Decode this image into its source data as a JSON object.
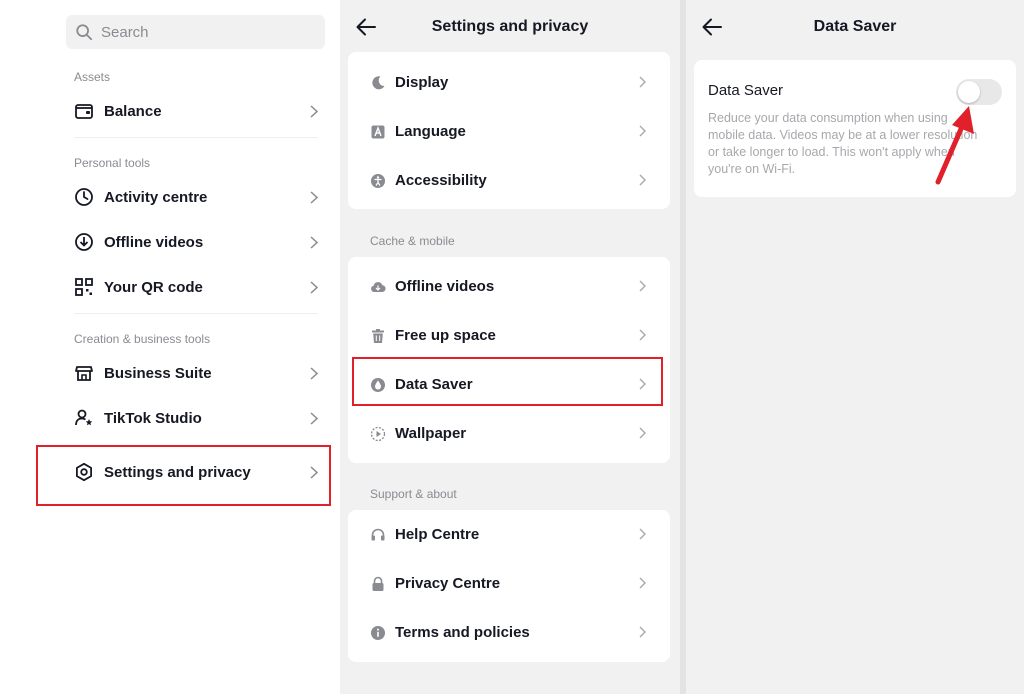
{
  "left": {
    "search_placeholder": "Search",
    "sections": {
      "assets": "Assets",
      "personal_tools": "Personal tools",
      "creation_business_tools": "Creation & business tools"
    },
    "items": {
      "balance": "Balance",
      "activity_centre": "Activity centre",
      "offline_videos": "Offline videos",
      "qr_code": "Your QR code",
      "business_suite": "Business Suite",
      "tiktok_studio": "TikTok Studio",
      "settings_privacy": "Settings and privacy"
    }
  },
  "middle": {
    "title": "Settings and privacy",
    "sections": {
      "cache_mobile": "Cache & mobile",
      "support_about": "Support & about"
    },
    "items": {
      "display": "Display",
      "language": "Language",
      "accessibility": "Accessibility",
      "offline_videos": "Offline videos",
      "free_up_space": "Free up space",
      "data_saver": "Data Saver",
      "wallpaper": "Wallpaper",
      "help_centre": "Help Centre",
      "privacy_centre": "Privacy Centre",
      "terms_policies": "Terms and policies"
    }
  },
  "right": {
    "title": "Data Saver",
    "setting_title": "Data Saver",
    "setting_description": "Reduce your data consumption when using mobile data. Videos may be at a lower resolution or take longer to load. This won't apply when you're on Wi-Fi.",
    "toggle_state": "off"
  },
  "colors": {
    "highlight_red": "#e0212b",
    "text_primary": "#161823",
    "text_secondary": "#8a8b91",
    "panel_grey": "#f1f1f2"
  },
  "icons": {
    "search": "search-icon",
    "balance": "wallet-icon",
    "activity": "clock-icon",
    "offline": "download-icon",
    "qr": "qr-code-icon",
    "business": "shop-icon",
    "studio": "person-star-icon",
    "settings": "gear-icon",
    "display": "moon-icon",
    "language": "language-icon",
    "accessibility": "accessibility-icon",
    "offline_cloud": "cloud-icon",
    "trash": "trash-icon",
    "data_saver": "droplet-icon",
    "wallpaper": "play-circle-icon",
    "help": "headset-icon",
    "privacy": "lock-icon",
    "terms": "info-icon"
  }
}
